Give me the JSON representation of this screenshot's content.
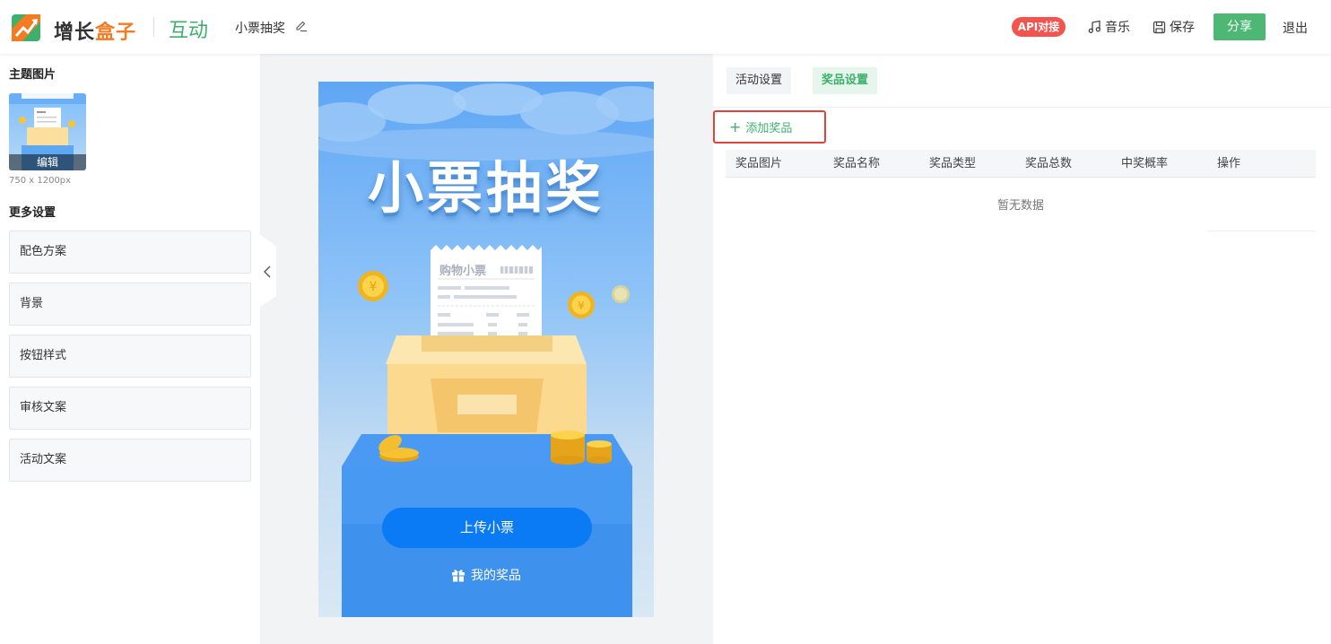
{
  "header": {
    "brand_part1": "增长",
    "brand_part2": "盒子",
    "app_name": "互动",
    "project_title": "小票抽奖",
    "api_badge": "API对接",
    "music_label": "音乐",
    "save_label": "保存",
    "share_label": "分享",
    "exit_label": "退出"
  },
  "left": {
    "theme_image_title": "主题图片",
    "edit_label": "编辑",
    "image_size": "750 x 1200px",
    "more_settings_title": "更多设置",
    "settings": [
      "配色方案",
      "背景",
      "按钮样式",
      "审核文案",
      "活动文案"
    ]
  },
  "preview": {
    "title": "小票抽奖",
    "receipt_title": "购物小票",
    "upload_button": "上传小票",
    "my_prizes": "我的奖品"
  },
  "right": {
    "tabs": [
      "活动设置",
      "奖品设置"
    ],
    "active_tab": "奖品设置",
    "add_prize": "添加奖品",
    "columns": [
      "奖品图片",
      "奖品名称",
      "奖品类型",
      "奖品总数",
      "中奖概率",
      "操作"
    ],
    "empty_text": "暂无数据"
  },
  "colors": {
    "brand_green": "#4db874",
    "brand_orange": "#f47b21",
    "api_red": "#f5534d",
    "upload_blue": "#0a7bf5",
    "highlight_red": "#e0433a"
  }
}
